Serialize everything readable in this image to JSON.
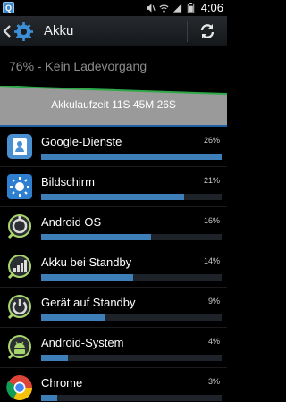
{
  "status_bar": {
    "time": "4:06",
    "notification_icon_letter": "Q",
    "icons": [
      "mute-icon",
      "wifi-icon",
      "signal-icon",
      "battery-icon"
    ]
  },
  "action_bar": {
    "title": "Akku",
    "icons": [
      "back-icon",
      "gear-icon",
      "refresh-icon"
    ]
  },
  "summary": {
    "status": "76% - Kein Ladevorgang",
    "runtime": "Akkulaufzeit 11S 45M 26S"
  },
  "colors": {
    "bar_fill": "#3f7fb9",
    "graph_line": "#2ea94a",
    "graph_fill": "#9a9a9a",
    "accent_line": "#1f5fa8"
  },
  "usage": [
    {
      "name": "Google-Dienste",
      "percent": "26%",
      "fill": 1.0,
      "icon": "google-services-icon"
    },
    {
      "name": "Bildschirm",
      "percent": "21%",
      "fill": 0.79,
      "icon": "display-brightness-icon"
    },
    {
      "name": "Android OS",
      "percent": "16%",
      "fill": 0.61,
      "icon": "android-os-icon"
    },
    {
      "name": "Akku bei Standby",
      "percent": "14%",
      "fill": 0.51,
      "icon": "cell-standby-icon"
    },
    {
      "name": "Gerät auf Standby",
      "percent": "9%",
      "fill": 0.35,
      "icon": "phone-idle-icon"
    },
    {
      "name": "Android-System",
      "percent": "4%",
      "fill": 0.15,
      "icon": "android-system-icon"
    },
    {
      "name": "Chrome",
      "percent": "3%",
      "fill": 0.09,
      "icon": "chrome-icon"
    }
  ]
}
